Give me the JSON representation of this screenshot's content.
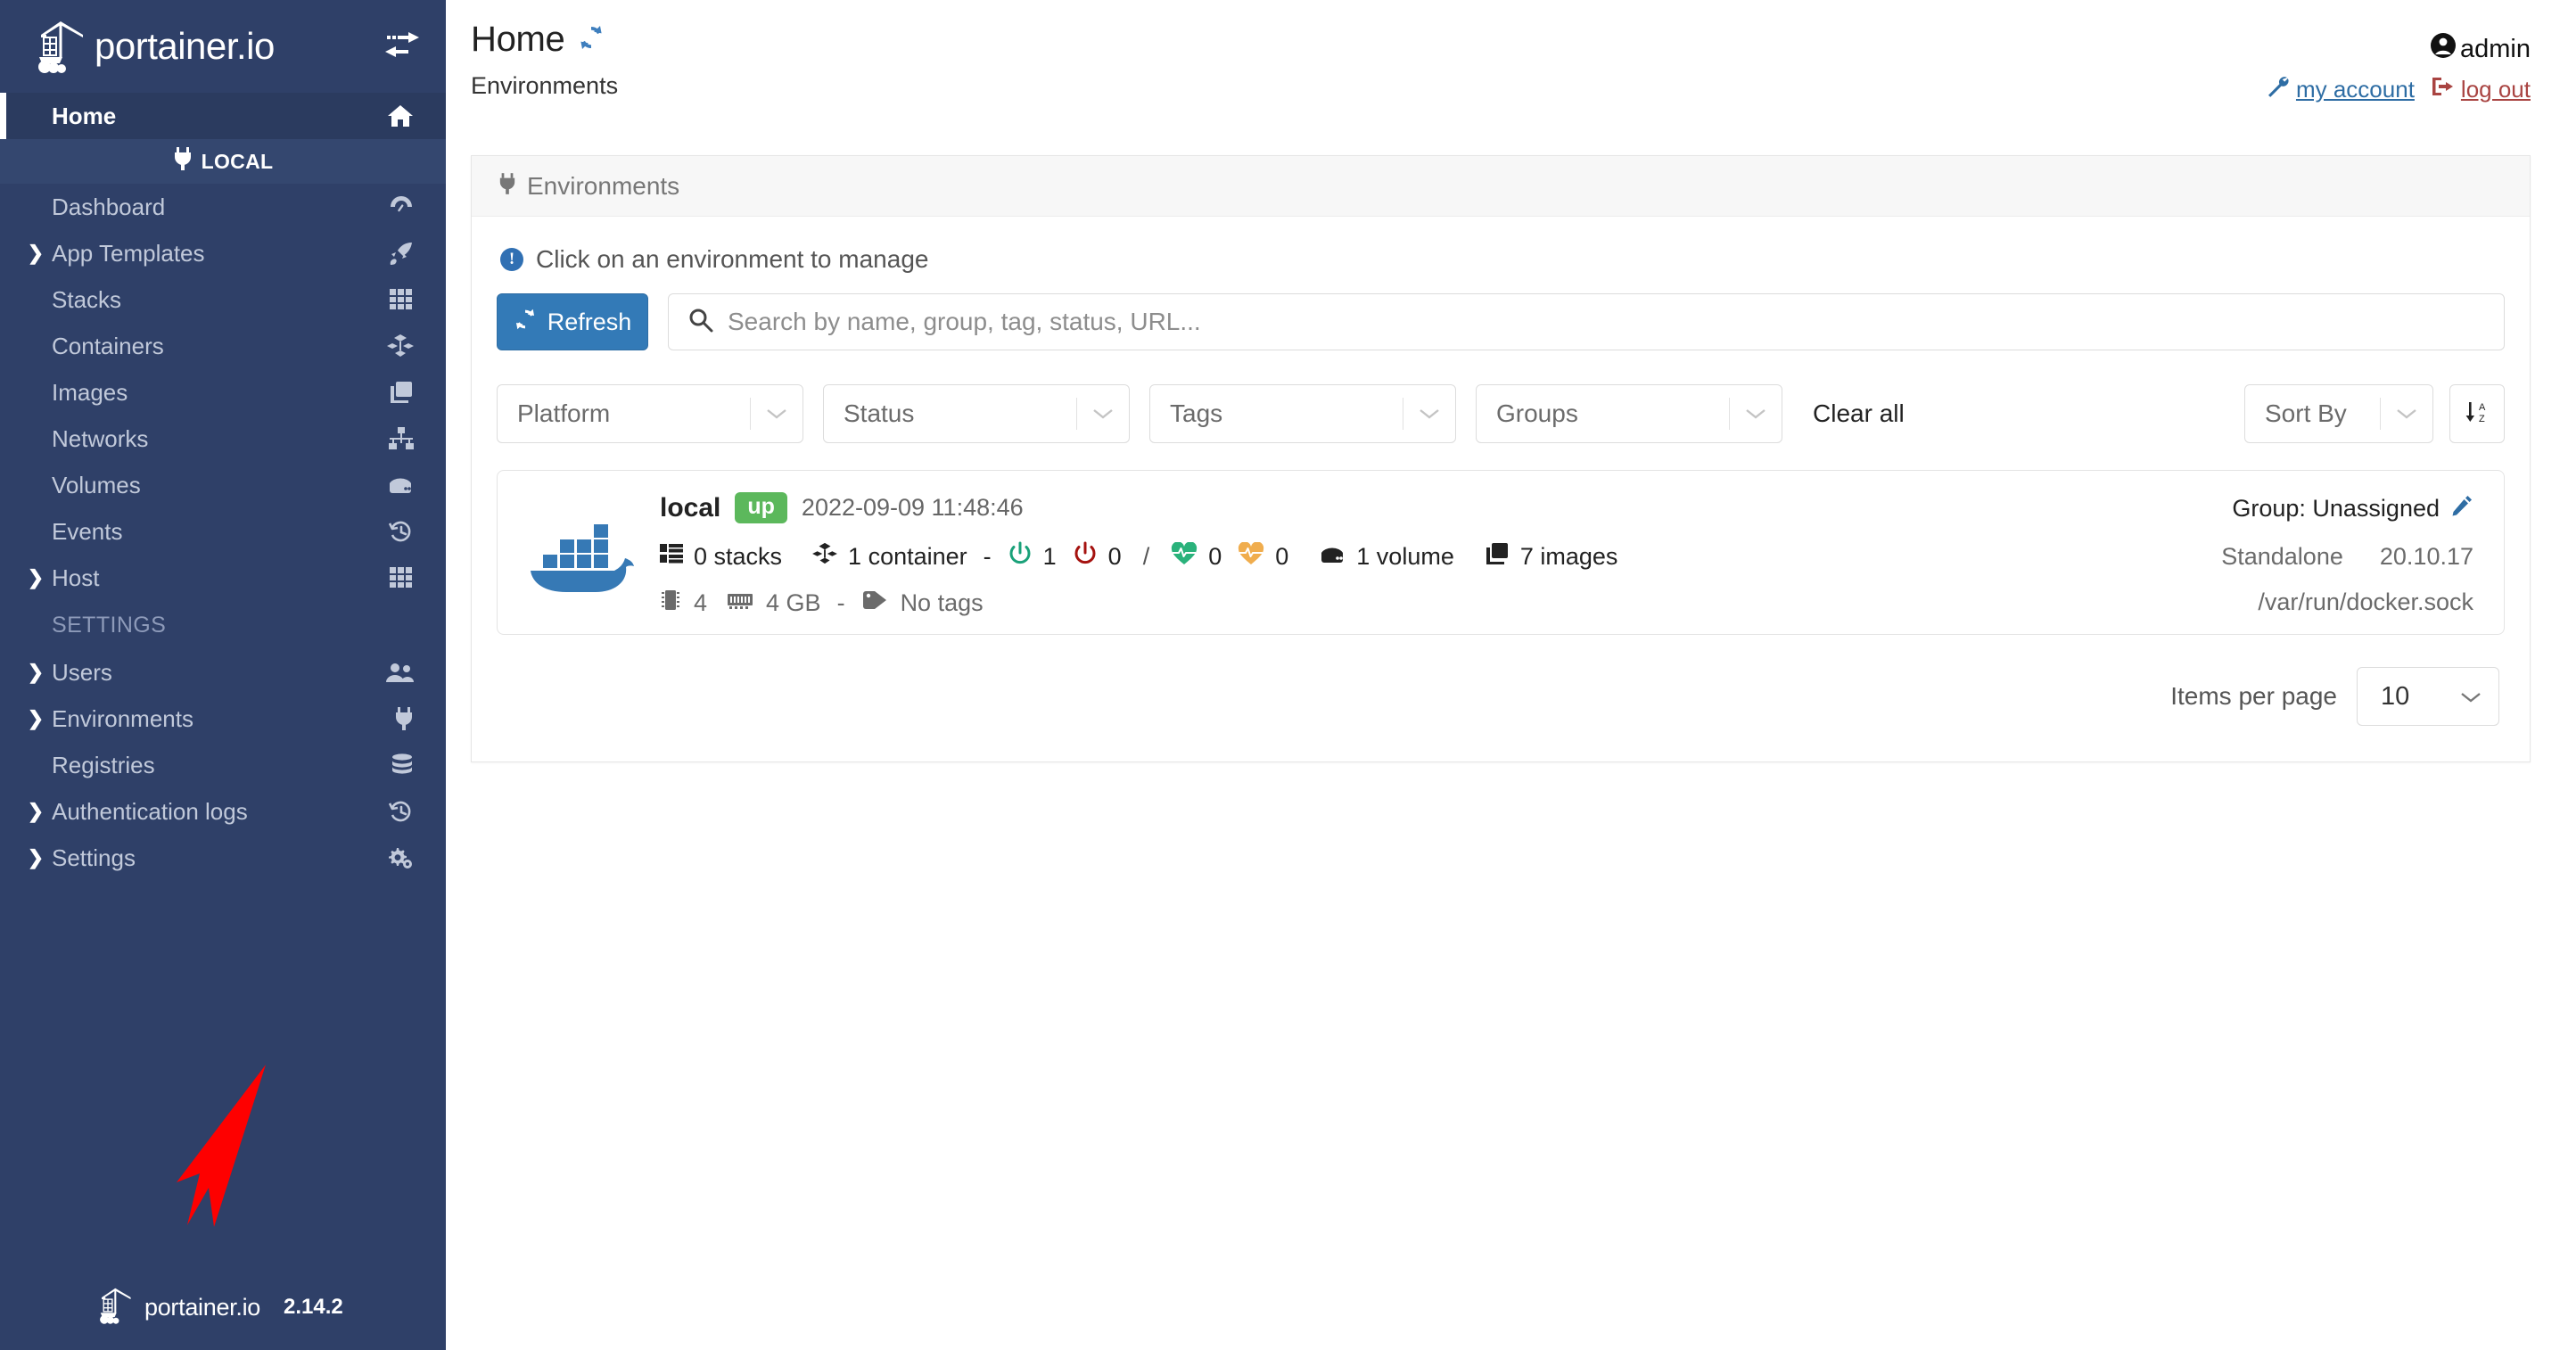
{
  "sidebar": {
    "brand": "portainer.io",
    "switch_icon": "environment-switch-icon",
    "env_label": "LOCAL",
    "settings_section": "SETTINGS",
    "footer_brand": "portainer.io",
    "version": "2.14.2",
    "items": [
      {
        "label": "Home",
        "icon": "home-icon",
        "caret": false,
        "active": true
      },
      {
        "label": "Dashboard",
        "icon": "dashboard-icon",
        "caret": false,
        "active": false
      },
      {
        "label": "App Templates",
        "icon": "rocket-icon",
        "caret": true,
        "active": false
      },
      {
        "label": "Stacks",
        "icon": "stacks-icon",
        "caret": false,
        "active": false
      },
      {
        "label": "Containers",
        "icon": "containers-icon",
        "caret": false,
        "active": false
      },
      {
        "label": "Images",
        "icon": "images-icon",
        "caret": false,
        "active": false
      },
      {
        "label": "Networks",
        "icon": "networks-icon",
        "caret": false,
        "active": false
      },
      {
        "label": "Volumes",
        "icon": "volumes-icon",
        "caret": false,
        "active": false
      },
      {
        "label": "Events",
        "icon": "history-icon",
        "caret": false,
        "active": false
      },
      {
        "label": "Host",
        "icon": "host-grid-icon",
        "caret": true,
        "active": false
      },
      {
        "label": "Users",
        "icon": "users-icon",
        "caret": true,
        "active": false
      },
      {
        "label": "Environments",
        "icon": "plug-icon",
        "caret": true,
        "active": false
      },
      {
        "label": "Registries",
        "icon": "database-icon",
        "caret": false,
        "active": false
      },
      {
        "label": "Authentication logs",
        "icon": "history-icon",
        "caret": true,
        "active": false
      },
      {
        "label": "Settings",
        "icon": "gears-icon",
        "caret": true,
        "active": false
      }
    ]
  },
  "header": {
    "title": "Home",
    "refresh_icon": "refresh-icon",
    "subtitle": "Environments",
    "user": "admin",
    "user_icon": "user-circle-icon",
    "my_account": "my account",
    "my_account_icon": "wrench-icon",
    "log_out": "log out",
    "log_out_icon": "sign-out-icon"
  },
  "panel": {
    "head_title": "Environments",
    "head_icon": "plug-icon",
    "info_text": "Click on an environment to manage",
    "refresh_button": "Refresh",
    "search_placeholder": "Search by name, group, tag, status, URL...",
    "search_value": "",
    "filters": [
      {
        "label": "Platform",
        "name": "platform"
      },
      {
        "label": "Status",
        "name": "status"
      },
      {
        "label": "Tags",
        "name": "tags"
      },
      {
        "label": "Groups",
        "name": "groups"
      }
    ],
    "clear_all": "Clear all",
    "sort_by": "Sort By",
    "sort_direction_icon": "sort-alpha-down-icon",
    "items_per_page_label": "Items per page",
    "items_per_page_value": "10"
  },
  "environment": {
    "logo": "docker-whale-icon",
    "name": "local",
    "status": "up",
    "snapshot_time": "2022-09-09 11:48:46",
    "stacks": "0 stacks",
    "containers": "1 container",
    "dash": "-",
    "running": "1",
    "stopped": "0",
    "slash": "/",
    "healthy": "0",
    "unhealthy": "0",
    "volumes": "1 volume",
    "images": "7 images",
    "cpu": "4",
    "memory": "4 GB",
    "hw_dash": "-",
    "tags": "No tags",
    "group": "Group: Unassigned",
    "group_edit_icon": "pencil-icon",
    "type": "Standalone",
    "version": "20.10.17",
    "url": "/var/run/docker.sock"
  },
  "colors": {
    "sidebar_bg": "#2f4068",
    "accent_blue": "#337ab7",
    "status_green": "#5cb85c",
    "running_green": "#1aa179",
    "stopped_red": "#a5120f",
    "healthy_green": "#2ab27b",
    "unhealthy_orange": "#f0ad4e",
    "docker_blue": "#3679b5",
    "arrow_red": "#fe0000"
  },
  "annotation": {
    "arrow_icon": "red-arrow-annotation"
  }
}
